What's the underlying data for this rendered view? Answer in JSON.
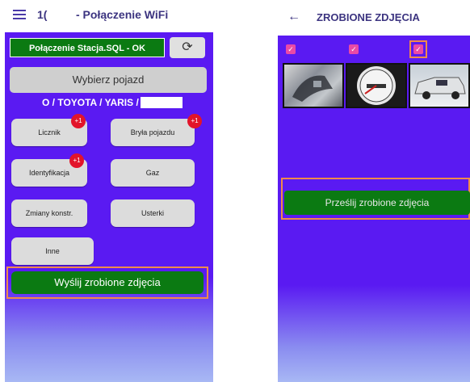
{
  "left": {
    "appbar": {
      "number": "1(",
      "title": "- Połączenie WiFi"
    },
    "sql_status": "Połączenie Stacja.SQL - OK",
    "select_vehicle_label": "Wybierz pojazd",
    "vehicle_text": "O / TOYOTA / YARIS / C",
    "buttons": [
      {
        "label": "Licznik",
        "badge": "+1"
      },
      {
        "label": "Bryła pojazdu",
        "badge": "+1"
      },
      {
        "label": "Identyfikacja",
        "badge": "+1"
      },
      {
        "label": "Gaz",
        "badge": ""
      },
      {
        "label": "Zmiany konstr.",
        "badge": ""
      },
      {
        "label": "Usterki",
        "badge": ""
      },
      {
        "label": "Inne",
        "badge": ""
      }
    ],
    "send_label": "Wyślij zrobione zdjęcia"
  },
  "right": {
    "title": "ZROBIONE ZDJĘCIA",
    "upload_label": "Prześlij zrobione zdjęcia"
  },
  "colors": {
    "purple": "#5a1af2",
    "green": "#0b7a12",
    "highlight": "#f08a4a",
    "badge": "#e2142a",
    "checkbox": "#e94aa6"
  }
}
